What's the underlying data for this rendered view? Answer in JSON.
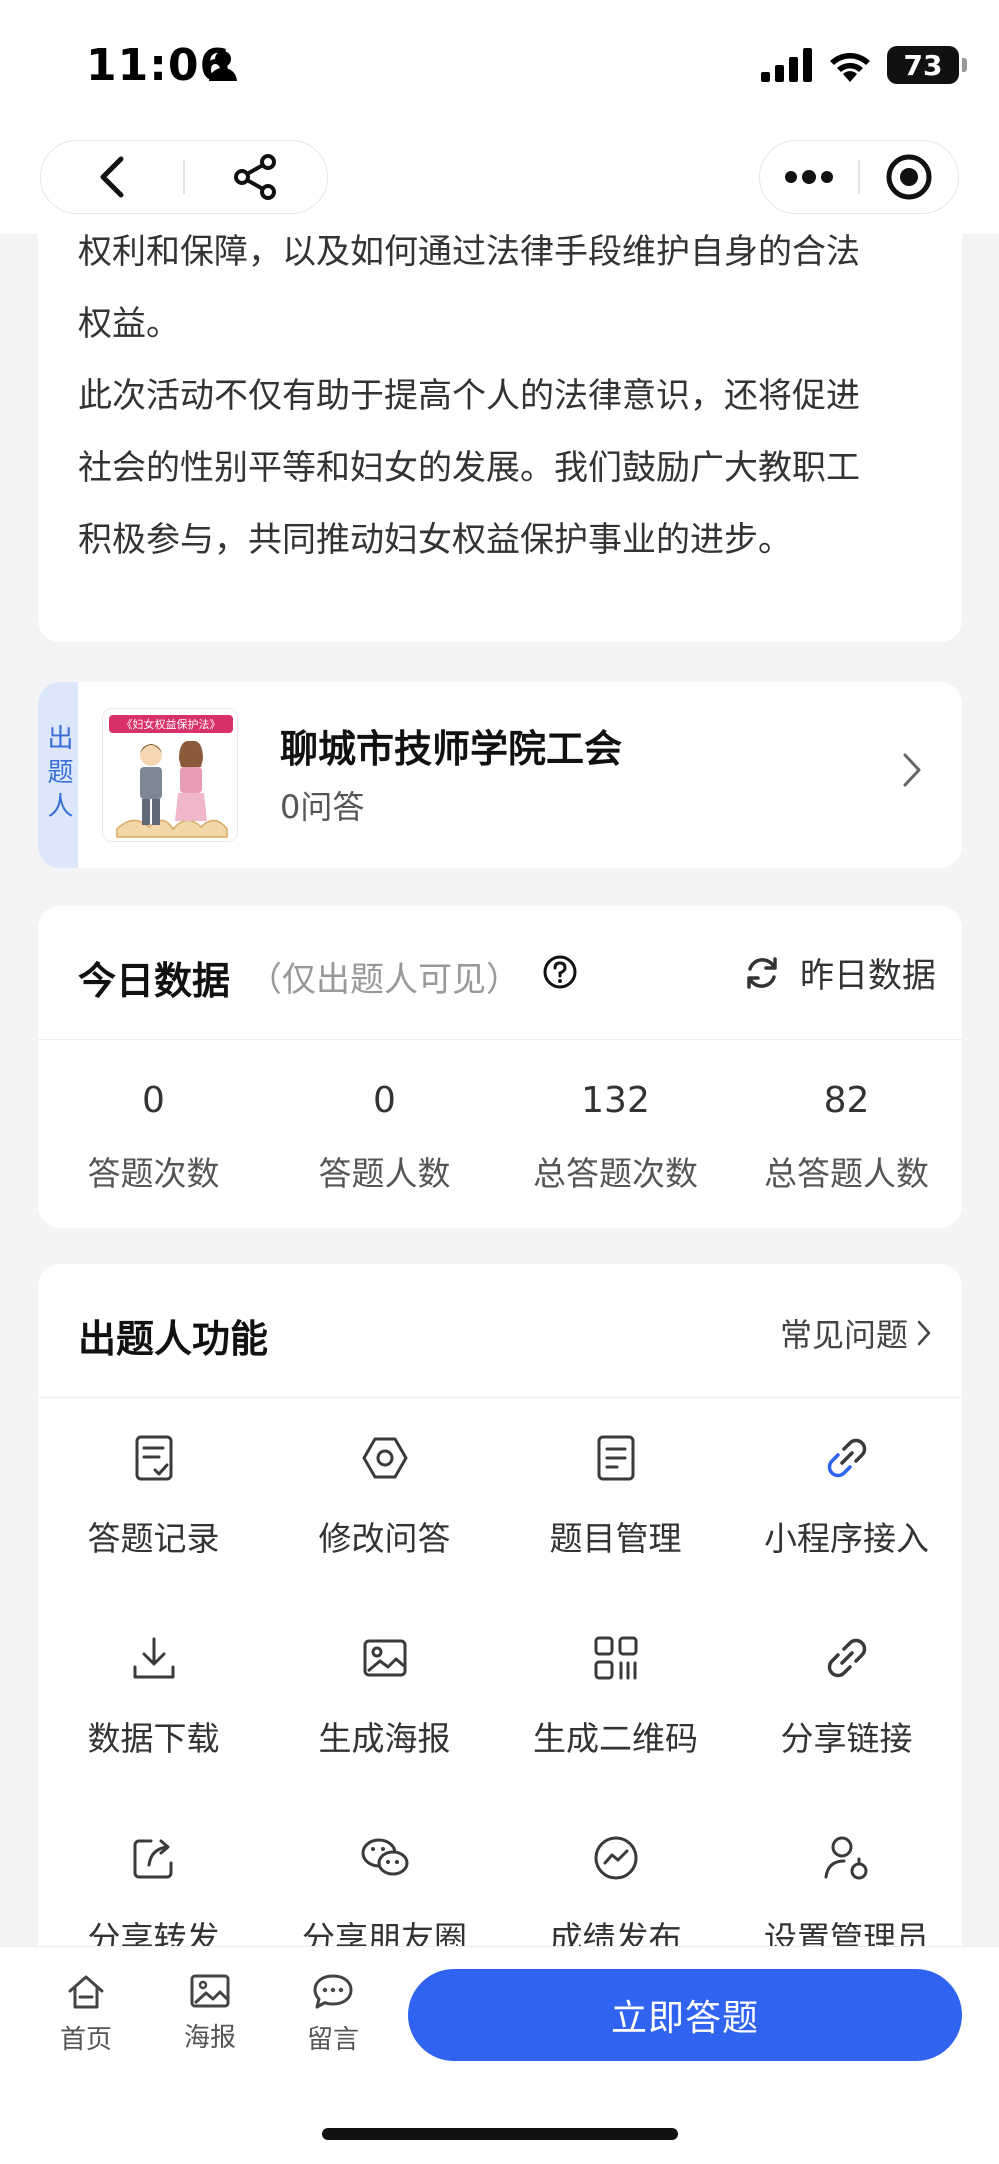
{
  "status_bar": {
    "time": "11:06",
    "battery": "73"
  },
  "intro": {
    "lines": [
      "权利和保障，以及如何通过法律手段维护自身的合法",
      "权益。",
      "此次活动不仅有助于提高个人的法律意识，还将促进",
      "社会的性别平等和妇女的发展。我们鼓励广大教职工",
      "积极参与，共同推动妇女权益保护事业的进步。"
    ]
  },
  "author": {
    "tag": "出题人",
    "avatar_caption": "《妇女权益保护法》",
    "name": "聊城市技师学院工会",
    "sub": "0问答"
  },
  "stats": {
    "title": "今日数据",
    "hint": "（仅出题人可见）",
    "yesterday_label": "昨日数据",
    "items": [
      {
        "value": "0",
        "label": "答题次数"
      },
      {
        "value": "0",
        "label": "答题人数"
      },
      {
        "value": "132",
        "label": "总答题次数"
      },
      {
        "value": "82",
        "label": "总答题人数"
      }
    ]
  },
  "functions": {
    "title": "出题人功能",
    "faq_label": "常见问题",
    "items": [
      {
        "label": "答题记录",
        "icon": "record-icon"
      },
      {
        "label": "修改问答",
        "icon": "edit-hexagon-icon"
      },
      {
        "label": "题目管理",
        "icon": "document-icon"
      },
      {
        "label": "小程序接入",
        "icon": "mini-program-link-icon"
      },
      {
        "label": "数据下载",
        "icon": "download-icon"
      },
      {
        "label": "生成海报",
        "icon": "image-icon"
      },
      {
        "label": "生成二维码",
        "icon": "qrcode-icon"
      },
      {
        "label": "分享链接",
        "icon": "link-icon"
      },
      {
        "label": "分享转发",
        "icon": "share-forward-icon"
      },
      {
        "label": "分享朋友圈",
        "icon": "wechat-moments-icon"
      },
      {
        "label": "成绩发布",
        "icon": "trend-icon"
      },
      {
        "label": "设置管理员",
        "icon": "admin-user-icon"
      }
    ]
  },
  "tabbar": {
    "home": "首页",
    "poster": "海报",
    "comment": "留言",
    "answer_button": "立即答题"
  },
  "colors": {
    "primary": "#2f63f0",
    "tag_bg": "#dde7fb",
    "tag_text": "#3a6fd8",
    "icon": "#3a3a3a"
  }
}
